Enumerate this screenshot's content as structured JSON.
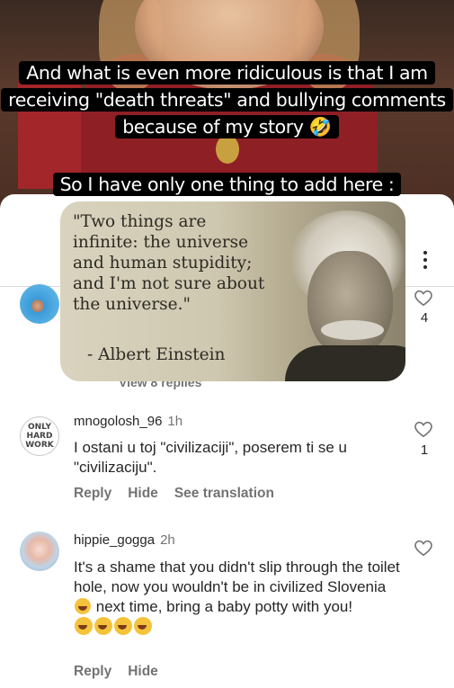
{
  "story": {
    "caption1": "And what is even more ridiculous is that I am receiving \"death threats\" and bullying comments because of my story 🤣",
    "caption2": "So I have only one thing to add here :"
  },
  "quote": {
    "text": "\"Two things are infinite: the universe and human stupidity; and I'm not sure about the universe.\"",
    "author": "- Albert Einstein"
  },
  "comments": [
    {
      "like_count": "4",
      "view_replies": "View 8 replies"
    },
    {
      "username": "mnogolosh_96",
      "time": "1h",
      "avatar_text": "ONLY\nHARD\nWORK",
      "text": "I ostani u toj \"civilizaciji\", poserem ti se u \"civilizaciju\".",
      "like_count": "1",
      "reply_label": "Reply",
      "hide_label": "Hide",
      "translate_label": "See translation"
    },
    {
      "username": "hippie_gogga",
      "time": "2h",
      "text_part1": "It's a shame that you didn't slip through the toilet hole, now you wouldn't be in civilized Slovenia",
      "text_part2": "next time, bring a baby potty with you!",
      "reply_label": "Reply",
      "hide_label": "Hide"
    }
  ],
  "icons": [
    "more-options-icon",
    "heart-icon",
    "laughing-emoji-icon",
    "smiling-emoji-icon"
  ],
  "colors": {
    "text": "#262626",
    "secondary": "#737373",
    "caption_bg": "#000000"
  }
}
